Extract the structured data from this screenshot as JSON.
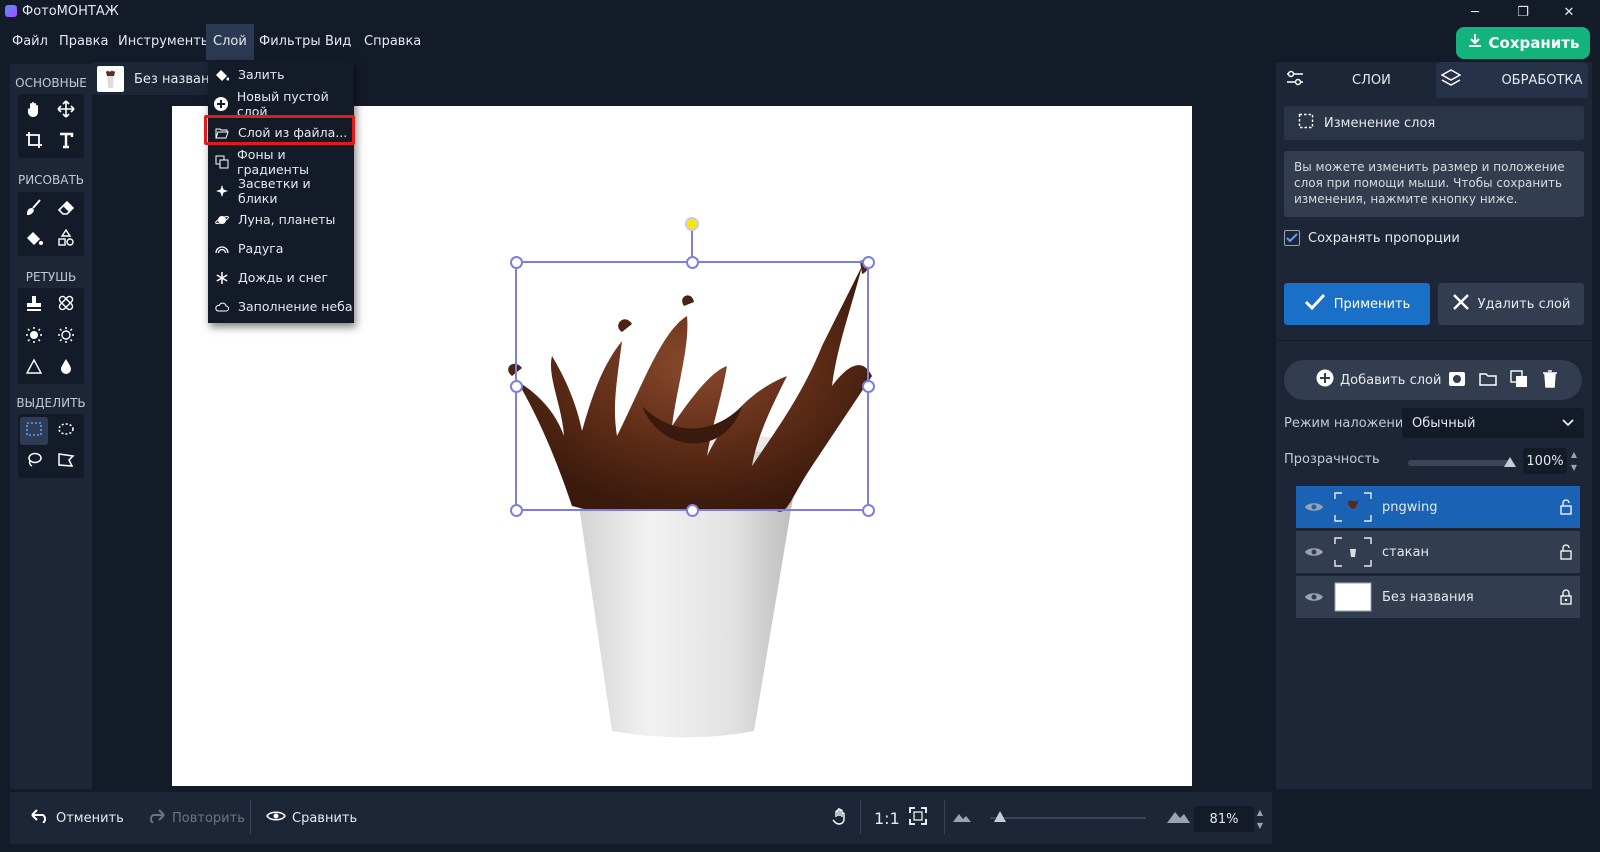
{
  "app": {
    "title": "ФотоМОНТАЖ"
  },
  "window_controls": {
    "minimize": "─",
    "restore": "❐",
    "close": "✕"
  },
  "menubar": {
    "items": [
      "Файл",
      "Правка",
      "Инструменты",
      "Слой",
      "Фильтры",
      "Вид",
      "Справка"
    ],
    "active": "Слой"
  },
  "save_button": {
    "label": "Сохранить",
    "color": "#14b37d"
  },
  "layer_menu": {
    "items": [
      {
        "label": "Залить",
        "icon": "fill-bucket-icon"
      },
      {
        "label": "Новый пустой слой",
        "icon": "plus-circle-icon"
      },
      {
        "label": "Слой из файла...",
        "icon": "folder-open-icon",
        "highlighted": true
      },
      {
        "label": "Фоны и градиенты",
        "icon": "gradient-icon"
      },
      {
        "label": "Засветки и блики",
        "icon": "sparkle-icon"
      },
      {
        "label": "Луна, планеты",
        "icon": "planet-icon"
      },
      {
        "label": "Радуга",
        "icon": "rainbow-icon"
      },
      {
        "label": "Дождь и снег",
        "icon": "snowflake-icon"
      },
      {
        "label": "Заполнение неба",
        "icon": "cloud-icon"
      }
    ],
    "highlight_color": "#e01b1b"
  },
  "document_tab": {
    "label": "Без названия"
  },
  "left_toolbar": {
    "sections": [
      "ОСНОВНЫЕ",
      "РИСОВАТЬ",
      "РЕТУШЬ",
      "ВЫДЕЛИТЬ"
    ]
  },
  "bottombar": {
    "undo": "Отменить",
    "redo": "Повторить",
    "compare": "Сравнить",
    "ratio": "1:1",
    "zoom": "81%"
  },
  "right_panel": {
    "tabs": {
      "layers": "СЛОИ",
      "processing": "ОБРАБОТКА"
    },
    "change_layer": "Изменение слоя",
    "hint": "Вы можете изменить размер и положение слоя при помощи мыши. Чтобы сохранить изменения, нажмите кнопку ниже.",
    "keep_ratio": "Сохранять пропорции",
    "keep_ratio_checked": true,
    "apply": "Применить",
    "delete_layer": "Удалить слой",
    "add_layer": "Добавить слой",
    "blend_label": "Режим наложения:",
    "blend_value": "Обычный",
    "opacity_label": "Прозрачность",
    "opacity_value": "100%",
    "layers": [
      {
        "name": "pngwing",
        "selected": true
      },
      {
        "name": "стакан",
        "selected": false
      },
      {
        "name": "Без названия",
        "selected": false
      }
    ],
    "accent_color": "#1a6fc6"
  }
}
